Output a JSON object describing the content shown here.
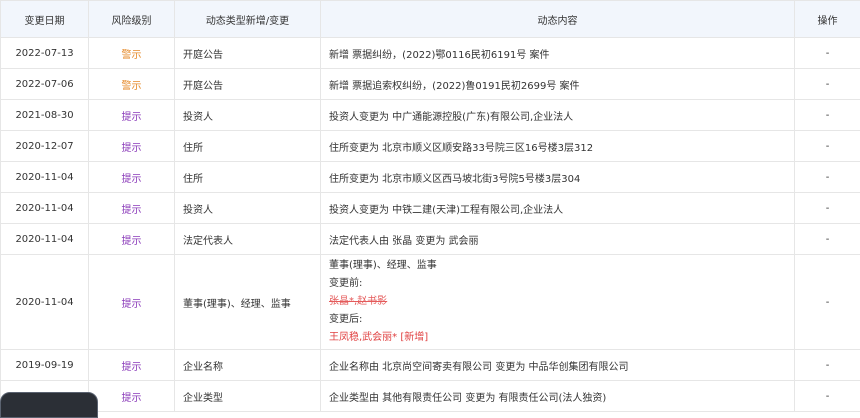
{
  "headers": {
    "date": "变更日期",
    "level": "风险级别",
    "type": "动态类型新增/变更",
    "content": "动态内容",
    "op": "操作"
  },
  "rows": [
    {
      "date": "2022-07-13",
      "level": "警示",
      "level_kind": "warn",
      "type": "开庭公告",
      "content": "新增 票据纠纷，(2022)鄂0116民初6191号 案件",
      "op": "-"
    },
    {
      "date": "2022-07-06",
      "level": "警示",
      "level_kind": "warn",
      "type": "开庭公告",
      "content": "新增 票据追索权纠纷，(2022)鲁0191民初2699号 案件",
      "op": "-"
    },
    {
      "date": "2021-08-30",
      "level": "提示",
      "level_kind": "tip",
      "type": "投资人",
      "content": "投资人变更为 中广通能源控股(广东)有限公司,企业法人",
      "op": "-"
    },
    {
      "date": "2020-12-07",
      "level": "提示",
      "level_kind": "tip",
      "type": "住所",
      "content": "住所变更为 北京市顺义区顺安路33号院三区16号楼3层312",
      "op": "-"
    },
    {
      "date": "2020-11-04",
      "level": "提示",
      "level_kind": "tip",
      "type": "住所",
      "content": "住所变更为 北京市顺义区西马坡北街3号院5号楼3层304",
      "op": "-"
    },
    {
      "date": "2020-11-04",
      "level": "提示",
      "level_kind": "tip",
      "type": "投资人",
      "content": "投资人变更为 中铁二建(天津)工程有限公司,企业法人",
      "op": "-"
    },
    {
      "date": "2020-11-04",
      "level": "提示",
      "level_kind": "tip",
      "type": "法定代表人",
      "content": "法定代表人由 张晶 变更为 武会丽",
      "op": "-"
    }
  ],
  "director_row": {
    "date": "2020-11-04",
    "level": "提示",
    "type": "董事(理事)、经理、监事",
    "line1": "董事(理事)、经理、监事",
    "before_label": "变更前:",
    "before_value": "张晶*,赵书影",
    "after_label": "变更后:",
    "after_value": "王凤稳,武会丽*",
    "added_tag": "[新增]",
    "op": "-"
  },
  "rows_after": [
    {
      "date": "2019-09-19",
      "level": "提示",
      "type": "企业名称",
      "content": "企业名称由 北京尚空间寄卖有限公司 变更为 中品华创集团有限公司",
      "op": "-"
    },
    {
      "date": "",
      "level": "提示",
      "type": "企业类型",
      "content": "企业类型由 其他有限责任公司 变更为 有限责任公司(法人独资)",
      "op": "-"
    }
  ],
  "colors": {
    "warn": "#e58a2a",
    "tip": "#8a3ab9",
    "header_bg": "#f2f6fc"
  }
}
